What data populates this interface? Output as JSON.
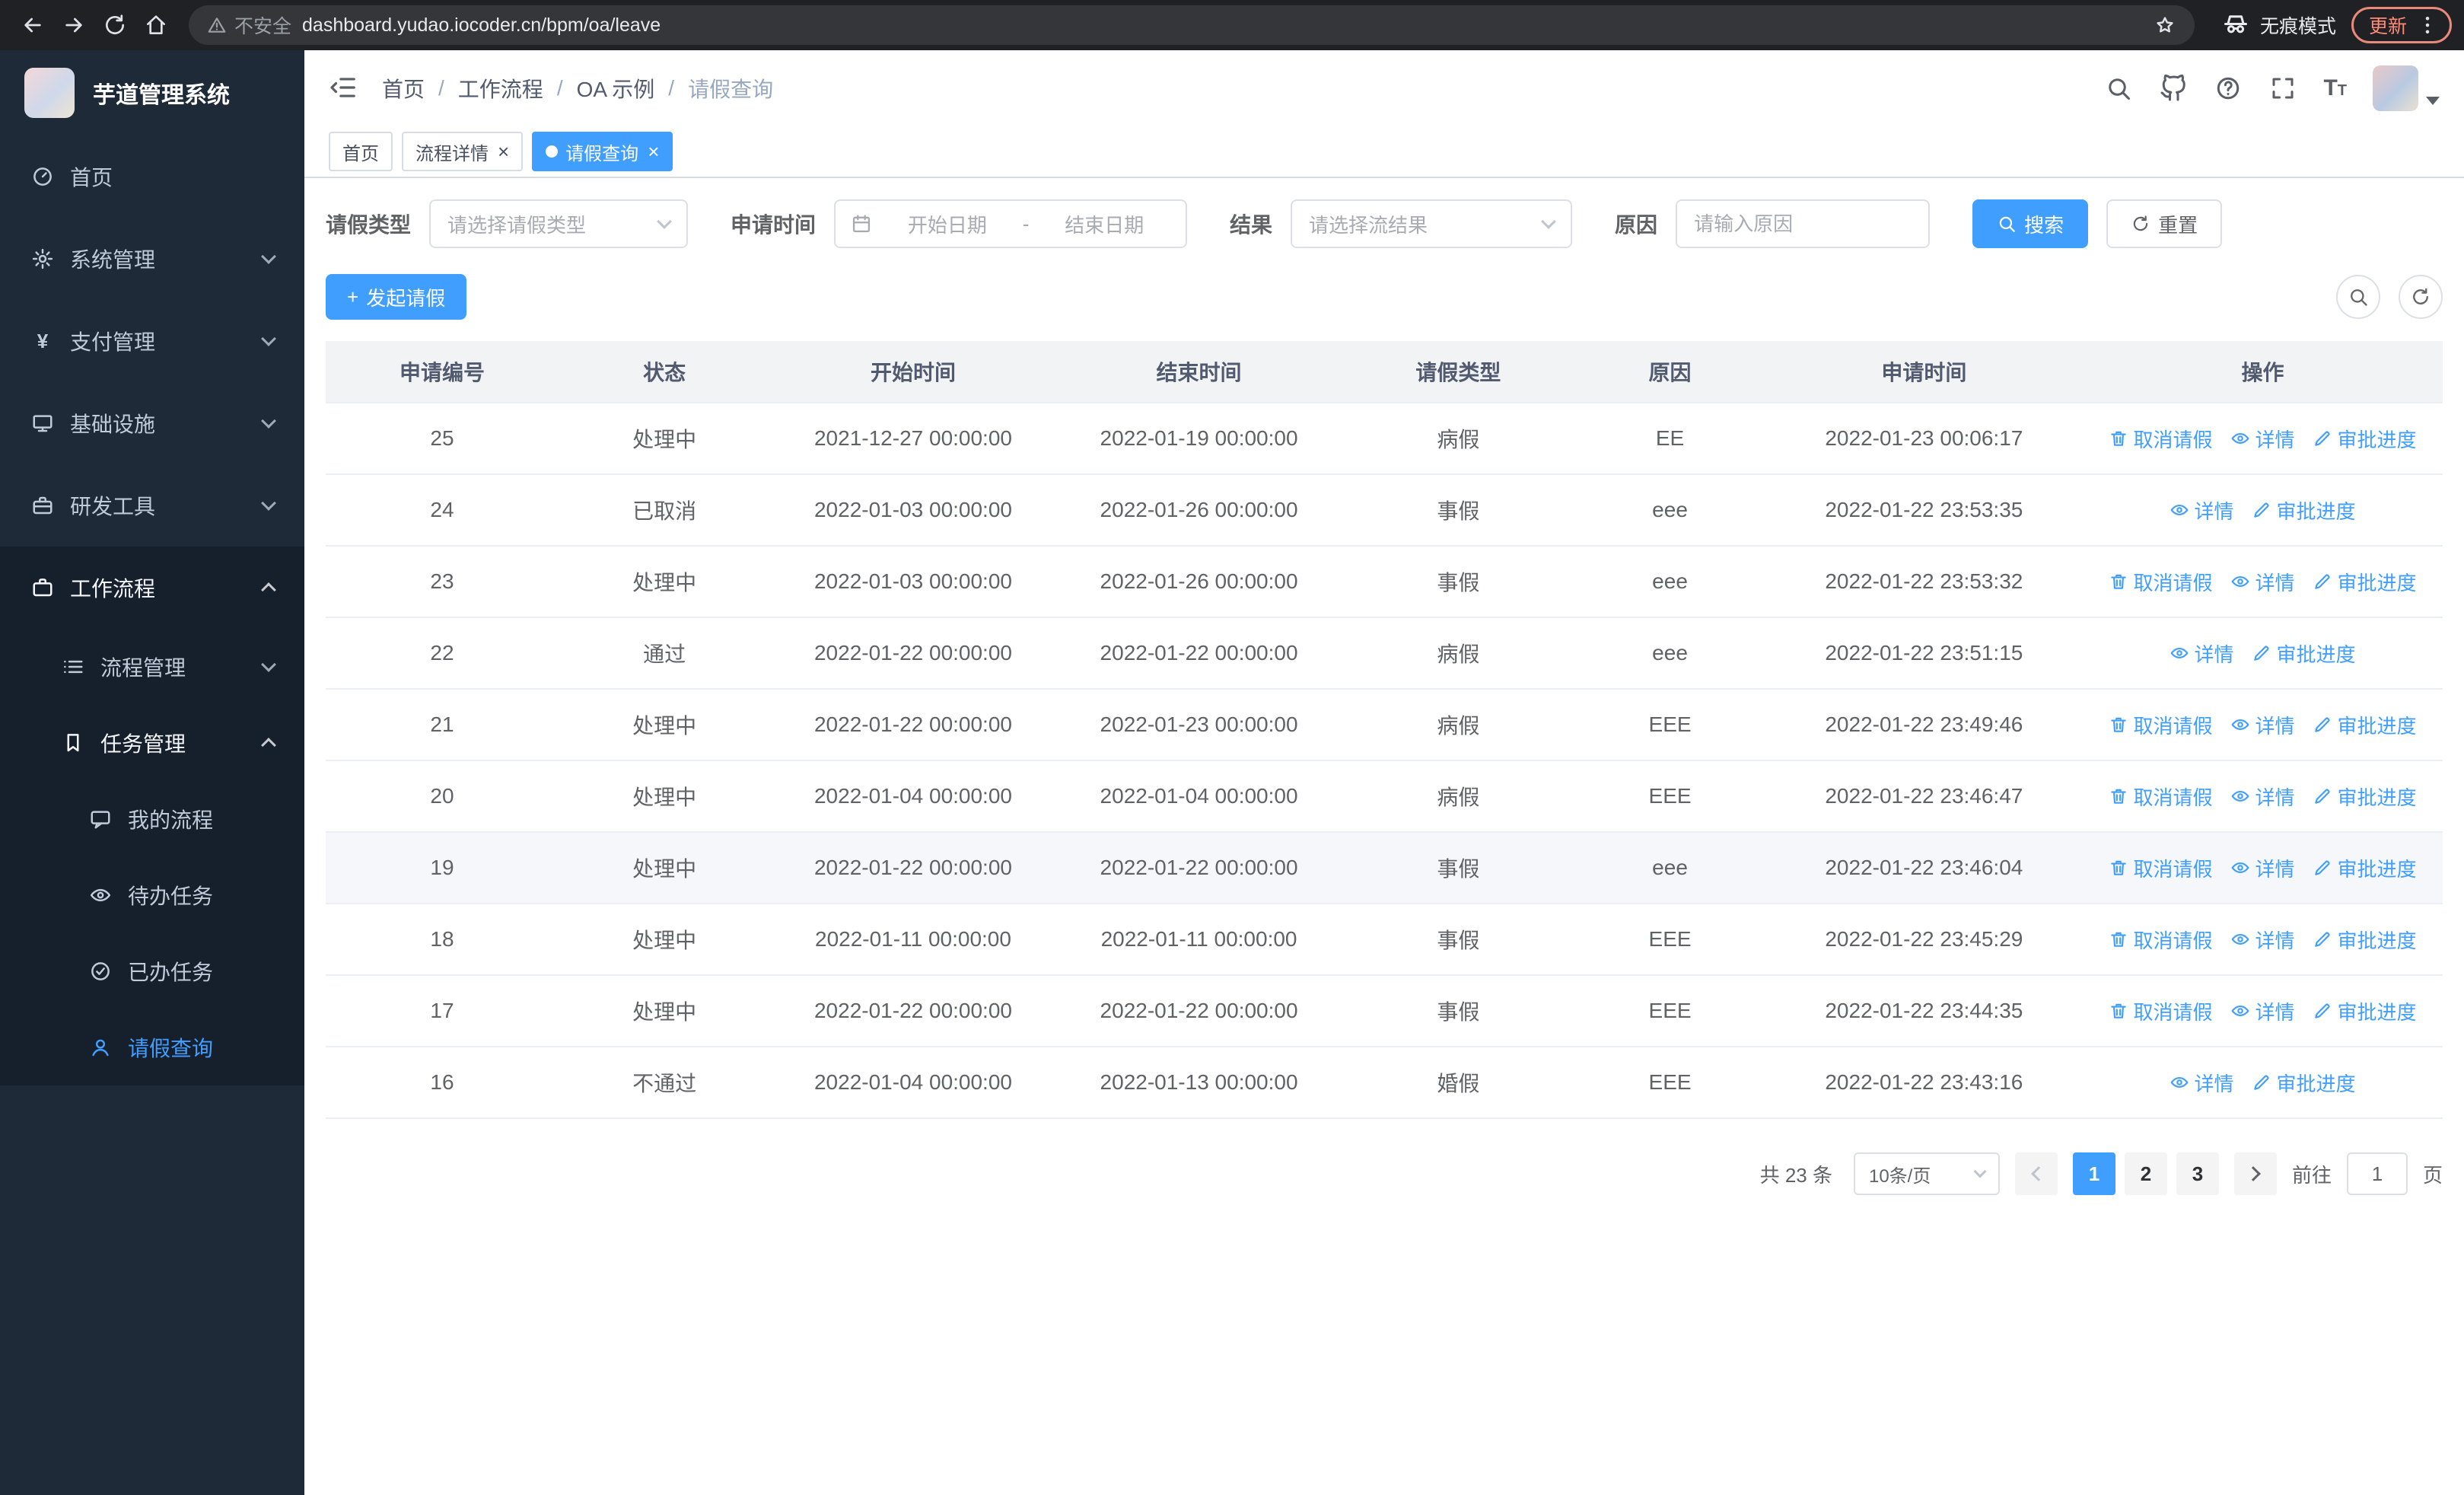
{
  "colors": {
    "primary": "#409eff",
    "sidebar_bg": "#1f2a39",
    "sidebar_section_bg": "#161f2c",
    "chrome_bg": "#202124"
  },
  "browser": {
    "security_label": "不安全",
    "url": "dashboard.yudao.iocoder.cn/bpm/oa/leave",
    "incognito_label": "无痕模式",
    "update_label": "更新"
  },
  "sidebar": {
    "app_title": "芋道管理系统",
    "menu": [
      {
        "key": "home",
        "label": "首页",
        "icon": "gauge",
        "level": 1
      },
      {
        "key": "system",
        "label": "系统管理",
        "icon": "gear",
        "level": 1,
        "chevron": "down"
      },
      {
        "key": "payment",
        "label": "支付管理",
        "icon": "yen",
        "level": 1,
        "chevron": "down"
      },
      {
        "key": "infra",
        "label": "基础设施",
        "icon": "monitor",
        "level": 1,
        "chevron": "down"
      },
      {
        "key": "devtools",
        "label": "研发工具",
        "icon": "toolbox",
        "level": 1,
        "chevron": "down"
      },
      {
        "key": "workflow",
        "label": "工作流程",
        "icon": "briefcase",
        "level": 1,
        "chevron": "up",
        "open": true,
        "section": true
      },
      {
        "key": "process",
        "label": "流程管理",
        "icon": "list",
        "level": 2,
        "chevron": "down",
        "section": true
      },
      {
        "key": "task",
        "label": "任务管理",
        "icon": "bookmark",
        "level": 2,
        "chevron": "up",
        "open": true,
        "section": true
      },
      {
        "key": "my-process",
        "label": "我的流程",
        "icon": "chat",
        "level": 3,
        "section": true
      },
      {
        "key": "todo-task",
        "label": "待办任务",
        "icon": "eye",
        "level": 3,
        "section": true
      },
      {
        "key": "done-task",
        "label": "已办任务",
        "icon": "check",
        "level": 3,
        "section": true
      },
      {
        "key": "leave-query",
        "label": "请假查询",
        "icon": "user",
        "level": 3,
        "section": true,
        "active": true
      }
    ]
  },
  "navbar": {
    "breadcrumb": [
      {
        "label": "首页"
      },
      {
        "label": "工作流程"
      },
      {
        "label": "OA 示例"
      },
      {
        "label": "请假查询",
        "current": true
      }
    ]
  },
  "tabs": [
    {
      "label": "首页"
    },
    {
      "label": "流程详情",
      "closable": true
    },
    {
      "label": "请假查询",
      "closable": true,
      "active": true
    }
  ],
  "filters": {
    "leave_type_label": "请假类型",
    "leave_type_placeholder": "请选择请假类型",
    "apply_time_label": "申请时间",
    "start_placeholder": "开始日期",
    "range_separator": "-",
    "end_placeholder": "结束日期",
    "result_label": "结果",
    "result_placeholder": "请选择流结果",
    "reason_label": "原因",
    "reason_placeholder": "请输入原因",
    "search_label": "搜索",
    "reset_label": "重置"
  },
  "toolbar": {
    "create_label": "发起请假"
  },
  "row_actions": {
    "cancel": "取消请假",
    "detail": "详情",
    "progress": "审批进度"
  },
  "table": {
    "columns": [
      "申请编号",
      "状态",
      "开始时间",
      "结束时间",
      "请假类型",
      "原因",
      "申请时间",
      "操作"
    ],
    "column_keys": [
      "apply-id",
      "status",
      "start-time",
      "end-time",
      "leave-type",
      "reason",
      "apply-time"
    ],
    "rows": [
      {
        "id": "25",
        "status": "处理中",
        "start_time": "2021-12-27 00:00:00",
        "end_time": "2022-01-19 00:00:00",
        "leave_type": "病假",
        "reason": "EE",
        "apply_time": "2022-01-23 00:06:17",
        "cancellable": true
      },
      {
        "id": "24",
        "status": "已取消",
        "start_time": "2022-01-03 00:00:00",
        "end_time": "2022-01-26 00:00:00",
        "leave_type": "事假",
        "reason": "eee",
        "apply_time": "2022-01-22 23:53:35",
        "cancellable": false
      },
      {
        "id": "23",
        "status": "处理中",
        "start_time": "2022-01-03 00:00:00",
        "end_time": "2022-01-26 00:00:00",
        "leave_type": "事假",
        "reason": "eee",
        "apply_time": "2022-01-22 23:53:32",
        "cancellable": true
      },
      {
        "id": "22",
        "status": "通过",
        "start_time": "2022-01-22 00:00:00",
        "end_time": "2022-01-22 00:00:00",
        "leave_type": "病假",
        "reason": "eee",
        "apply_time": "2022-01-22 23:51:15",
        "cancellable": false
      },
      {
        "id": "21",
        "status": "处理中",
        "start_time": "2022-01-22 00:00:00",
        "end_time": "2022-01-23 00:00:00",
        "leave_type": "病假",
        "reason": "EEE",
        "apply_time": "2022-01-22 23:49:46",
        "cancellable": true
      },
      {
        "id": "20",
        "status": "处理中",
        "start_time": "2022-01-04 00:00:00",
        "end_time": "2022-01-04 00:00:00",
        "leave_type": "病假",
        "reason": "EEE",
        "apply_time": "2022-01-22 23:46:47",
        "cancellable": true
      },
      {
        "id": "19",
        "status": "处理中",
        "start_time": "2022-01-22 00:00:00",
        "end_time": "2022-01-22 00:00:00",
        "leave_type": "事假",
        "reason": "eee",
        "apply_time": "2022-01-22 23:46:04",
        "cancellable": true,
        "hovered": true
      },
      {
        "id": "18",
        "status": "处理中",
        "start_time": "2022-01-11 00:00:00",
        "end_time": "2022-01-11 00:00:00",
        "leave_type": "事假",
        "reason": "EEE",
        "apply_time": "2022-01-22 23:45:29",
        "cancellable": true
      },
      {
        "id": "17",
        "status": "处理中",
        "start_time": "2022-01-22 00:00:00",
        "end_time": "2022-01-22 00:00:00",
        "leave_type": "事假",
        "reason": "EEE",
        "apply_time": "2022-01-22 23:44:35",
        "cancellable": true
      },
      {
        "id": "16",
        "status": "不通过",
        "start_time": "2022-01-04 00:00:00",
        "end_time": "2022-01-13 00:00:00",
        "leave_type": "婚假",
        "reason": "EEE",
        "apply_time": "2022-01-22 23:43:16",
        "cancellable": false
      }
    ]
  },
  "pagination": {
    "total": "共 23 条",
    "page_size": "10条/页",
    "pages": [
      "1",
      "2",
      "3"
    ],
    "active_page": "1",
    "goto_label": "前往",
    "goto_value": "1",
    "goto_unit": "页"
  },
  "icons": {
    "back-icon": "left-arrow",
    "forward-icon": "right-arrow",
    "reload-icon": "circular-arrow",
    "home-icon": "house",
    "warning-icon": "triangle-exclamation",
    "star-icon": "bookmark-star",
    "incognito-icon": "spy-hat-glasses",
    "kebab-menu-icon": "vertical-dots",
    "search-icon": "magnifier",
    "github-icon": "octocat",
    "help-icon": "question-circle",
    "fullscreen-icon": "corner-brackets",
    "font-size-icon": "double-T",
    "calendar-icon": "calendar",
    "refresh-icon": "circular-arrow",
    "plus-icon": "plus",
    "trash-icon": "trash-can",
    "eye-icon": "eye",
    "edit-icon": "pencil"
  }
}
